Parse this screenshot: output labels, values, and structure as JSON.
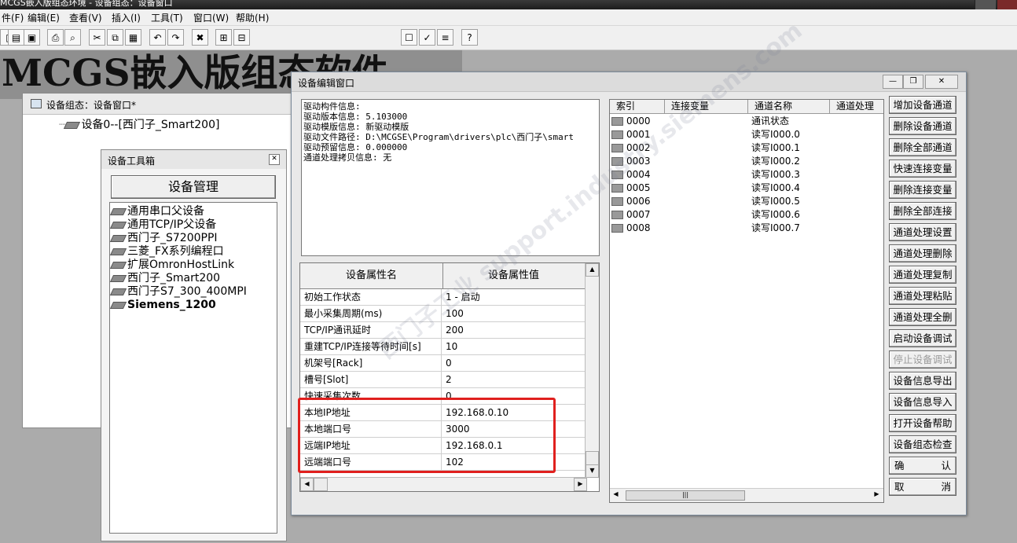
{
  "app": {
    "title": "MCGS嵌入版组态环境 - 设备组态：设备窗口",
    "brand_text": "MCGS嵌入版组态软件"
  },
  "menu": [
    {
      "label": "件(F)"
    },
    {
      "label": "编辑(E)"
    },
    {
      "label": "查看(V)"
    },
    {
      "label": "插入(I)"
    },
    {
      "label": "工具(T)"
    },
    {
      "label": "窗口(W)"
    },
    {
      "label": "帮助(H)"
    }
  ],
  "device_window": {
    "title": "设备组态：设备窗口*",
    "tree_item": "设备0--[西门子_Smart200]"
  },
  "toolbox": {
    "title": "设备工具箱",
    "manage_button": "设备管理",
    "items": [
      {
        "label": "通用串口父设备",
        "bold": false
      },
      {
        "label": "通用TCP/IP父设备",
        "bold": false
      },
      {
        "label": "西门子_S7200PPI",
        "bold": false
      },
      {
        "label": "三菱_FX系列编程口",
        "bold": false
      },
      {
        "label": "扩展OmronHostLink",
        "bold": false
      },
      {
        "label": "西门子_Smart200",
        "bold": false
      },
      {
        "label": "西门子S7_300_400MPI",
        "bold": false
      },
      {
        "label": "Siemens_1200",
        "bold": true
      }
    ]
  },
  "edit_window": {
    "title": "设备编辑窗口",
    "driver_info": [
      "驱动构件信息:",
      "驱动版本信息: 5.103000",
      "驱动模版信息: 新驱动模版",
      "驱动文件路径: D:\\MCGSE\\Program\\drivers\\plc\\西门子\\smart",
      "驱动预留信息: 0.000000",
      "通道处理拷贝信息: 无"
    ],
    "props_header": {
      "name": "设备属性名",
      "value": "设备属性值"
    },
    "props": [
      {
        "name": "初始工作状态",
        "value": "1 - 启动"
      },
      {
        "name": "最小采集周期(ms)",
        "value": "100"
      },
      {
        "name": "TCP/IP通讯延时",
        "value": "200"
      },
      {
        "name": "重建TCP/IP连接等待时间[s]",
        "value": "10"
      },
      {
        "name": "机架号[Rack]",
        "value": "0"
      },
      {
        "name": "槽号[Slot]",
        "value": "2"
      },
      {
        "name": "快速采集次数",
        "value": "0"
      },
      {
        "name": "本地IP地址",
        "value": "192.168.0.10"
      },
      {
        "name": "本地端口号",
        "value": "3000"
      },
      {
        "name": "远端IP地址",
        "value": "192.168.0.1"
      },
      {
        "name": "远端端口号",
        "value": "102"
      }
    ],
    "channel_header": {
      "index": "索引",
      "var": "连接变量",
      "name": "通道名称",
      "proc": "通道处理"
    },
    "channels": [
      {
        "index": "0000",
        "name": "通讯状态"
      },
      {
        "index": "0001",
        "name": "读写I000.0"
      },
      {
        "index": "0002",
        "name": "读写I000.1"
      },
      {
        "index": "0003",
        "name": "读写I000.2"
      },
      {
        "index": "0004",
        "name": "读写I000.3"
      },
      {
        "index": "0005",
        "name": "读写I000.4"
      },
      {
        "index": "0006",
        "name": "读写I000.5"
      },
      {
        "index": "0007",
        "name": "读写I000.6"
      },
      {
        "index": "0008",
        "name": "读写I000.7"
      }
    ],
    "buttons": [
      {
        "label": "增加设备通道",
        "disabled": false
      },
      {
        "label": "删除设备通道",
        "disabled": false
      },
      {
        "label": "删除全部通道",
        "disabled": false
      },
      {
        "label": "快速连接变量",
        "disabled": false
      },
      {
        "label": "删除连接变量",
        "disabled": false
      },
      {
        "label": "删除全部连接",
        "disabled": false
      },
      {
        "label": "通道处理设置",
        "disabled": false
      },
      {
        "label": "通道处理删除",
        "disabled": false
      },
      {
        "label": "通道处理复制",
        "disabled": false
      },
      {
        "label": "通道处理粘贴",
        "disabled": false
      },
      {
        "label": "通道处理全删",
        "disabled": false
      },
      {
        "label": "启动设备调试",
        "disabled": false
      },
      {
        "label": "停止设备调试",
        "disabled": true
      },
      {
        "label": "设备信息导出",
        "disabled": false
      },
      {
        "label": "设备信息导入",
        "disabled": false
      },
      {
        "label": "打开设备帮助",
        "disabled": false
      },
      {
        "label": "设备组态检查",
        "disabled": false
      }
    ],
    "confirm": [
      "确",
      "认"
    ],
    "cancel": [
      "取",
      "消"
    ]
  },
  "watermark": "西门子工业 support.industry.siemens.com",
  "icons": {
    "minimize": "minimize-icon",
    "restore": "restore-icon",
    "close": "close-icon",
    "chip": "device-chip-icon"
  }
}
